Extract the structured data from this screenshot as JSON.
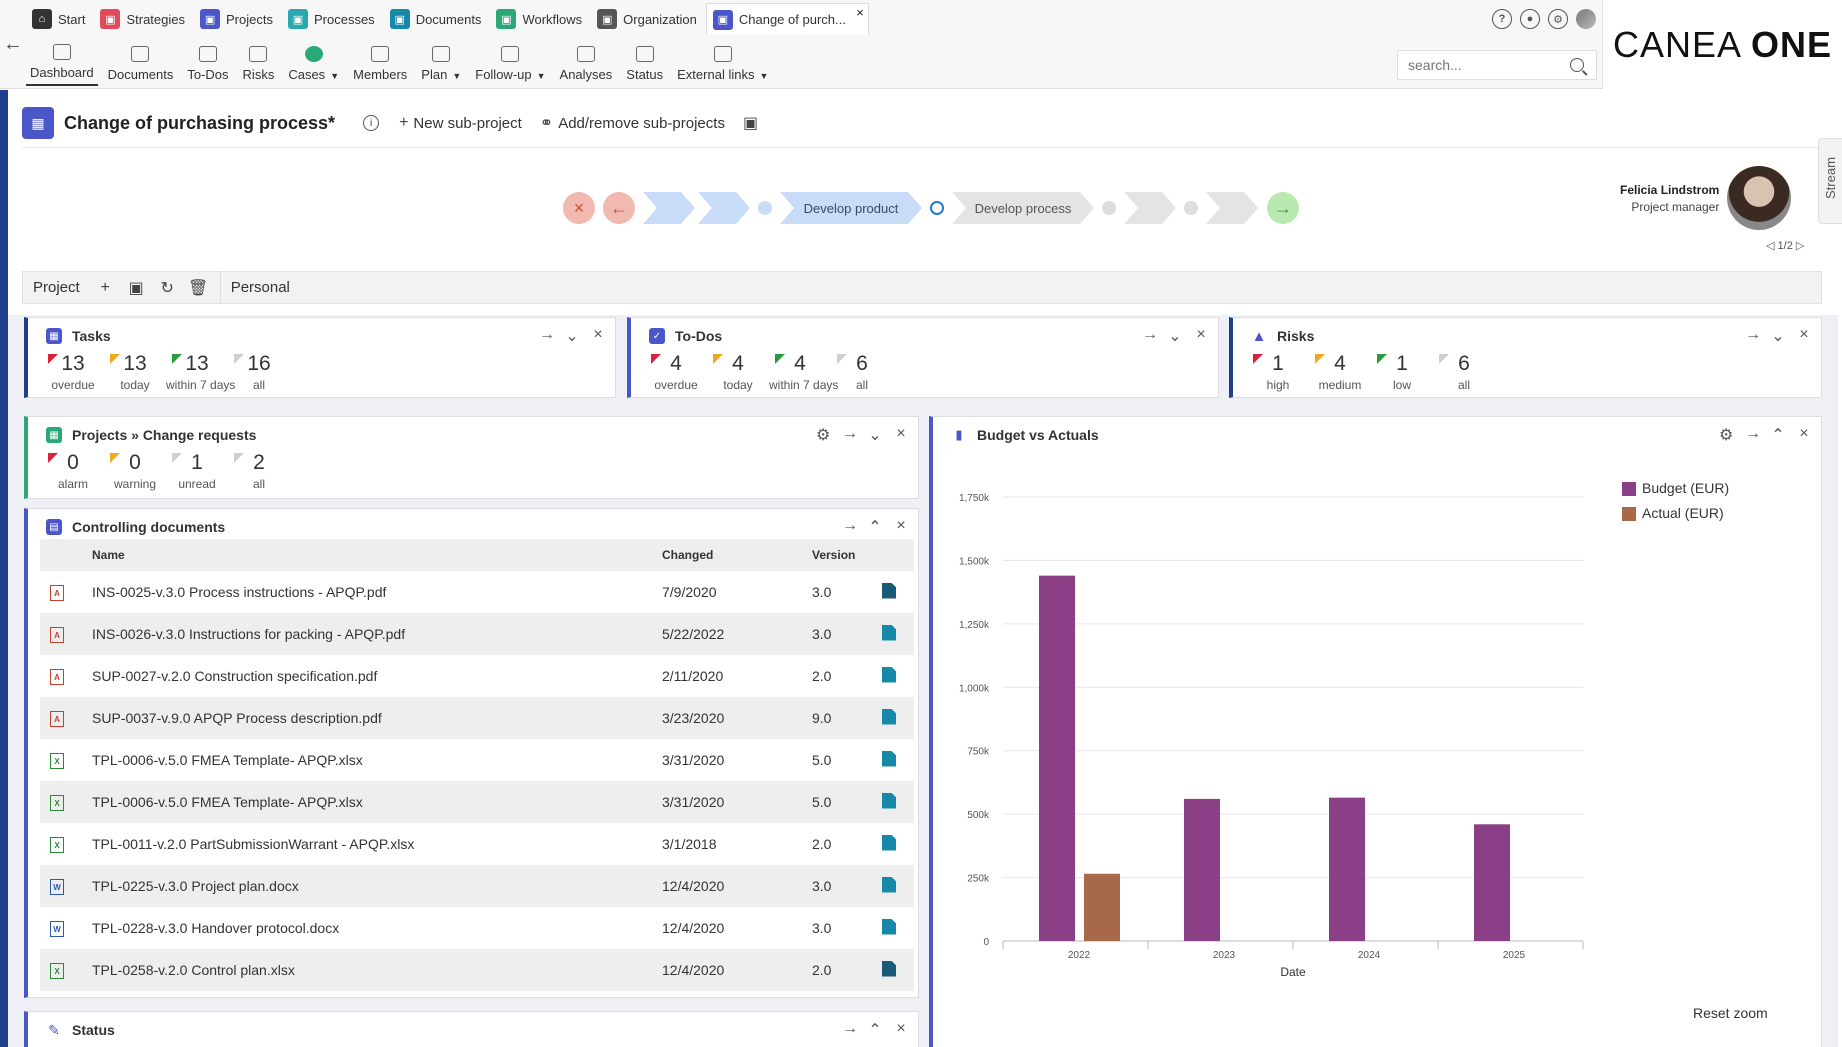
{
  "app_tabs": [
    {
      "label": "Start",
      "color": "#333333",
      "icon": "home-icon"
    },
    {
      "label": "Strategies",
      "color": "#e14a5a",
      "icon": "strategies-icon"
    },
    {
      "label": "Projects",
      "color": "#4b56c8",
      "icon": "projects-icon"
    },
    {
      "label": "Processes",
      "color": "#2aa8b0",
      "icon": "processes-icon"
    },
    {
      "label": "Documents",
      "color": "#1888a8",
      "icon": "documents-icon"
    },
    {
      "label": "Workflows",
      "color": "#2aa876",
      "icon": "workflows-icon"
    },
    {
      "label": "Organization",
      "color": "#555555",
      "icon": "organization-icon"
    },
    {
      "label": "Change of purch...",
      "color": "#4b56c8",
      "icon": "project-tab-icon",
      "close": "×"
    }
  ],
  "subnav": [
    {
      "label": "Dashboard",
      "active": true
    },
    {
      "label": "Documents"
    },
    {
      "label": "To-Dos"
    },
    {
      "label": "Risks"
    },
    {
      "label": "Cases",
      "dropdown": true
    },
    {
      "label": "Members"
    },
    {
      "label": "Plan",
      "dropdown": true
    },
    {
      "label": "Follow-up",
      "dropdown": true
    },
    {
      "label": "Analyses"
    },
    {
      "label": "Status"
    },
    {
      "label": "External links",
      "dropdown": true
    }
  ],
  "search": {
    "placeholder": "search..."
  },
  "brand": {
    "light": "CANEA ",
    "bold": "ONE"
  },
  "title": {
    "text": "Change of purchasing process*",
    "new_sub": "New sub-project",
    "add_remove": "Add/remove sub-projects"
  },
  "process": {
    "steps": [
      "",
      "",
      "Develop product",
      "Develop process",
      "",
      ""
    ]
  },
  "manager": {
    "name": "Felicia Lindstrom",
    "role": "Project manager",
    "pager": "1/2"
  },
  "stream": {
    "label": "Stream"
  },
  "toolbar": {
    "project_label": "Project",
    "personal_label": "Personal"
  },
  "tasks": {
    "title": "Tasks",
    "counters": [
      {
        "value": "13",
        "caption": "overdue",
        "flag": "red"
      },
      {
        "value": "13",
        "caption": "today",
        "flag": "yellow"
      },
      {
        "value": "13",
        "caption": "within 7 days",
        "flag": "green"
      },
      {
        "value": "16",
        "caption": "all",
        "flag": "gray"
      }
    ]
  },
  "todos": {
    "title": "To-Dos",
    "counters": [
      {
        "value": "4",
        "caption": "overdue",
        "flag": "red"
      },
      {
        "value": "4",
        "caption": "today",
        "flag": "yellow"
      },
      {
        "value": "4",
        "caption": "within 7 days",
        "flag": "green"
      },
      {
        "value": "6",
        "caption": "all",
        "flag": "gray"
      }
    ]
  },
  "risks": {
    "title": "Risks",
    "counters": [
      {
        "value": "1",
        "caption": "high",
        "flag": "red"
      },
      {
        "value": "4",
        "caption": "medium",
        "flag": "yellow"
      },
      {
        "value": "1",
        "caption": "low",
        "flag": "green"
      },
      {
        "value": "6",
        "caption": "all",
        "flag": "gray"
      }
    ]
  },
  "change_requests": {
    "title": "Projects » Change requests",
    "counters": [
      {
        "value": "0",
        "caption": "alarm",
        "flag": "red"
      },
      {
        "value": "0",
        "caption": "warning",
        "flag": "yellow"
      },
      {
        "value": "1",
        "caption": "unread",
        "flag": "gray"
      },
      {
        "value": "2",
        "caption": "all",
        "flag": "gray"
      }
    ]
  },
  "documents": {
    "title": "Controlling documents",
    "headers": {
      "name": "Name",
      "changed": "Changed",
      "version": "Version"
    },
    "rows": [
      {
        "type": "pdf",
        "name": "INS-0025-v.3.0 Process instructions - APQP.pdf",
        "changed": "7/9/2020",
        "version": "3.0",
        "action": "edit"
      },
      {
        "type": "pdf",
        "name": "INS-0026-v.3.0 Instructions for packing - APQP.pdf",
        "changed": "5/22/2022",
        "version": "3.0",
        "action": "view"
      },
      {
        "type": "pdf",
        "name": "SUP-0027-v.2.0 Construction specification.pdf",
        "changed": "2/11/2020",
        "version": "2.0",
        "action": "view"
      },
      {
        "type": "pdf",
        "name": "SUP-0037-v.9.0 APQP Process description.pdf",
        "changed": "3/23/2020",
        "version": "9.0",
        "action": "view"
      },
      {
        "type": "xls",
        "name": "TPL-0006-v.5.0 FMEA Template- APQP.xlsx",
        "changed": "3/31/2020",
        "version": "5.0",
        "action": "view"
      },
      {
        "type": "xls",
        "name": "TPL-0006-v.5.0 FMEA Template- APQP.xlsx",
        "changed": "3/31/2020",
        "version": "5.0",
        "action": "view"
      },
      {
        "type": "xls",
        "name": "TPL-0011-v.2.0 PartSubmissionWarrant - APQP.xlsx",
        "changed": "3/1/2018",
        "version": "2.0",
        "action": "view"
      },
      {
        "type": "doc",
        "name": "TPL-0225-v.3.0 Project plan.docx",
        "changed": "12/4/2020",
        "version": "3.0",
        "action": "view"
      },
      {
        "type": "doc",
        "name": "TPL-0228-v.3.0 Handover protocol.docx",
        "changed": "12/4/2020",
        "version": "3.0",
        "action": "view"
      },
      {
        "type": "xls",
        "name": "TPL-0258-v.2.0 Control plan.xlsx",
        "changed": "12/4/2020",
        "version": "2.0",
        "action": "edit"
      }
    ]
  },
  "status_widget": {
    "title": "Status"
  },
  "budget": {
    "title": "Budget vs Actuals",
    "reset_zoom": "Reset zoom"
  },
  "chart_data": {
    "type": "bar",
    "categories": [
      "2022",
      "2023",
      "2024",
      "2025"
    ],
    "series": [
      {
        "name": "Budget (EUR)",
        "color": "#8a3f86",
        "values": [
          1440000,
          560000,
          565000,
          460000
        ]
      },
      {
        "name": "Actual (EUR)",
        "color": "#a8694a",
        "values": [
          265000,
          0,
          0,
          0
        ]
      }
    ],
    "xlabel": "Date",
    "ylabel": "",
    "ylim": [
      0,
      1750000
    ],
    "yticks": [
      "0",
      "250k",
      "500k",
      "750k",
      "1,000k",
      "1,250k",
      "1,500k",
      "1,750k"
    ],
    "legend": "top-right",
    "grid": true
  }
}
